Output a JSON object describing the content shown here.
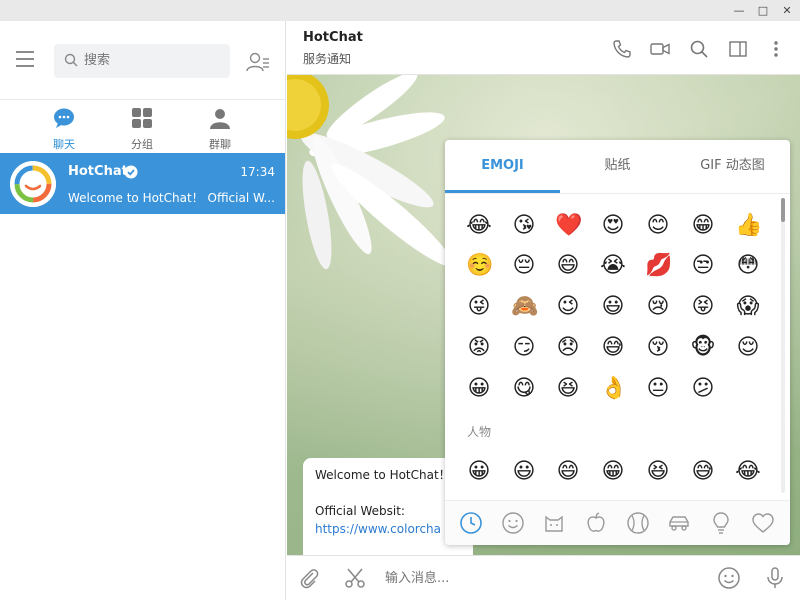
{
  "window": {
    "minimize": "—",
    "maximize": "□",
    "close": "✕"
  },
  "left": {
    "search_placeholder": "搜索",
    "tabs": [
      {
        "label": "聊天",
        "icon": "chat-icon",
        "active": true
      },
      {
        "label": "分组",
        "icon": "grid-icon",
        "active": false
      },
      {
        "label": "群聊",
        "icon": "group-icon",
        "active": false
      }
    ],
    "chats": [
      {
        "name": "HotChat",
        "time": "17:34",
        "preview": "Welcome to HotChat！ Official W...",
        "verified": true
      }
    ]
  },
  "header": {
    "title": "HotChat",
    "subtitle": "服务通知"
  },
  "message": {
    "line1": "Welcome to HotChat！",
    "line2": "Official Websit:",
    "link": "https://www.colorcha"
  },
  "emoji_panel": {
    "tabs": [
      "EMOJI",
      "贴纸",
      "GIF 动态图"
    ],
    "active_tab": "EMOJI",
    "section_label": "人物",
    "recent": [
      "😂",
      "😘",
      "❤️",
      "😍",
      "😊",
      "😁",
      "👍",
      "☺️",
      "😔",
      "😄",
      "😭",
      "💋",
      "😒",
      "😳",
      "😜",
      "🙈",
      "😉",
      "😃",
      "😢",
      "😝",
      "😱",
      "😡",
      "😏",
      "😞",
      "😅",
      "😚",
      "🐵",
      "😌",
      "😀",
      "😋",
      "😆",
      "👌",
      "😐",
      "😕"
    ],
    "people": [
      "😀",
      "😃",
      "😄",
      "😁",
      "😆",
      "😅",
      "😂"
    ],
    "categories": [
      "clock-icon",
      "smiley-icon",
      "cat-icon",
      "apple-icon",
      "ball-icon",
      "car-icon",
      "bulb-icon",
      "heart-icon"
    ]
  },
  "input": {
    "placeholder": "输入消息..."
  },
  "colors": {
    "accent": "#3b93d9",
    "selected_row": "#3b93d9"
  }
}
